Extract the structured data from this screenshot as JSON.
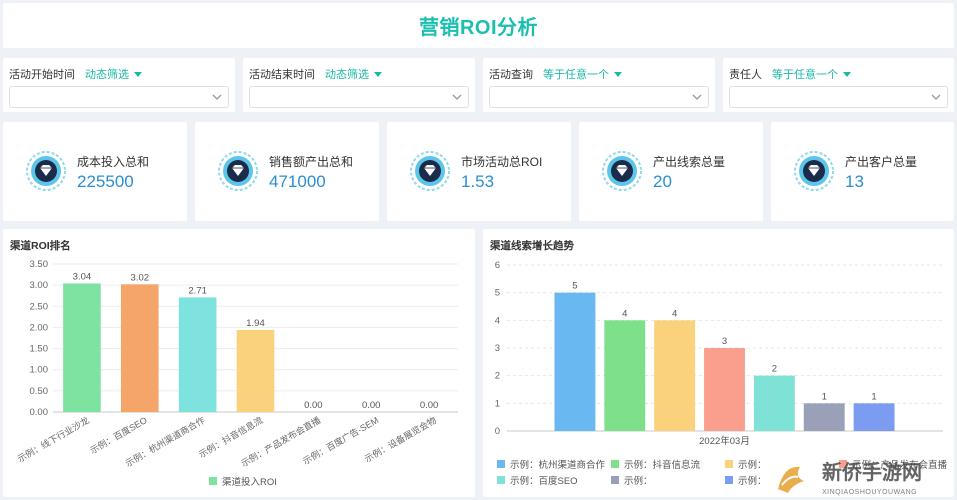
{
  "title": "营销ROI分析",
  "filters": [
    {
      "label": "活动开始时间",
      "op": "动态筛选"
    },
    {
      "label": "活动结束时间",
      "op": "动态筛选"
    },
    {
      "label": "活动查询",
      "op": "等于任意一个"
    },
    {
      "label": "责任人",
      "op": "等于任意一个"
    }
  ],
  "kpis": [
    {
      "label": "成本投入总和",
      "value": "225500"
    },
    {
      "label": "销售额产出总和",
      "value": "471000"
    },
    {
      "label": "市场活动总ROI",
      "value": "1.53"
    },
    {
      "label": "产出线索总量",
      "value": "20"
    },
    {
      "label": "产出客户总量",
      "value": "13"
    }
  ],
  "chart1_title": "渠道ROI排名",
  "chart2_title": "渠道线索增长趋势",
  "chart_data": [
    {
      "type": "bar",
      "title": "渠道ROI排名",
      "categories": [
        "示例：线下行业沙龙",
        "示例：百度SEO",
        "示例：杭州渠道商合作",
        "示例：抖音信息流",
        "示例：产品发布会直播",
        "示例：百度广告-SEM",
        "示例：设备展览会物"
      ],
      "series": [
        {
          "name": "渠道投入ROI",
          "values": [
            3.04,
            3.02,
            2.71,
            1.94,
            0.0,
            0.0,
            0.0
          ]
        }
      ],
      "data_labels": [
        "3.04",
        "3.02",
        "2.71",
        "1.94",
        "0.00",
        "0.00",
        "0.00"
      ],
      "colors": [
        "#7ee2a0",
        "#f5a46a",
        "#7ee3de",
        "#fbd27c"
      ],
      "ylim": [
        0,
        3.5
      ],
      "yticks": [
        "0.00",
        "0.50",
        "1.00",
        "1.50",
        "2.00",
        "2.50",
        "3.00",
        "3.50"
      ],
      "legend": "bottom"
    },
    {
      "type": "bar",
      "title": "渠道线索增长趋势",
      "categories": [
        "2022年03月"
      ],
      "series": [
        {
          "name": "示例：杭州渠道商合作",
          "values": [
            5
          ],
          "color": "#6ab8f2"
        },
        {
          "name": "示例：抖音信息流",
          "values": [
            4
          ],
          "color": "#7ee08a"
        },
        {
          "name": "示例：线下行业沙龙",
          "values": [
            4
          ],
          "color": "#fbd27c"
        },
        {
          "name": "示例：百度广告-SEM",
          "values": [
            3
          ],
          "color": "#fa9e8e"
        },
        {
          "name": "示例：产品发布会直播",
          "values": [
            2
          ],
          "color": "#7ee3d6"
        },
        {
          "name": "示例：百度SEO",
          "values": [
            1
          ],
          "color": "#9aa0b8"
        },
        {
          "name": "示例：设备展览会物",
          "values": [
            1
          ],
          "color": "#7b9cf0"
        }
      ],
      "legend_texts": [
        "示例：杭州渠道商合作",
        "示例：抖音信息流",
        "示例：",
        "示例：产品发布会直播",
        "示例：百度SEO",
        "示例：",
        "示例："
      ],
      "ylim": [
        0,
        6
      ],
      "yticks": [
        "0",
        "1",
        "2",
        "3",
        "4",
        "5",
        "6"
      ],
      "legend": "bottom"
    }
  ],
  "watermark_text": "新侨手游网",
  "watermark_sub": "XINQIAOSHOUYOUWANG"
}
